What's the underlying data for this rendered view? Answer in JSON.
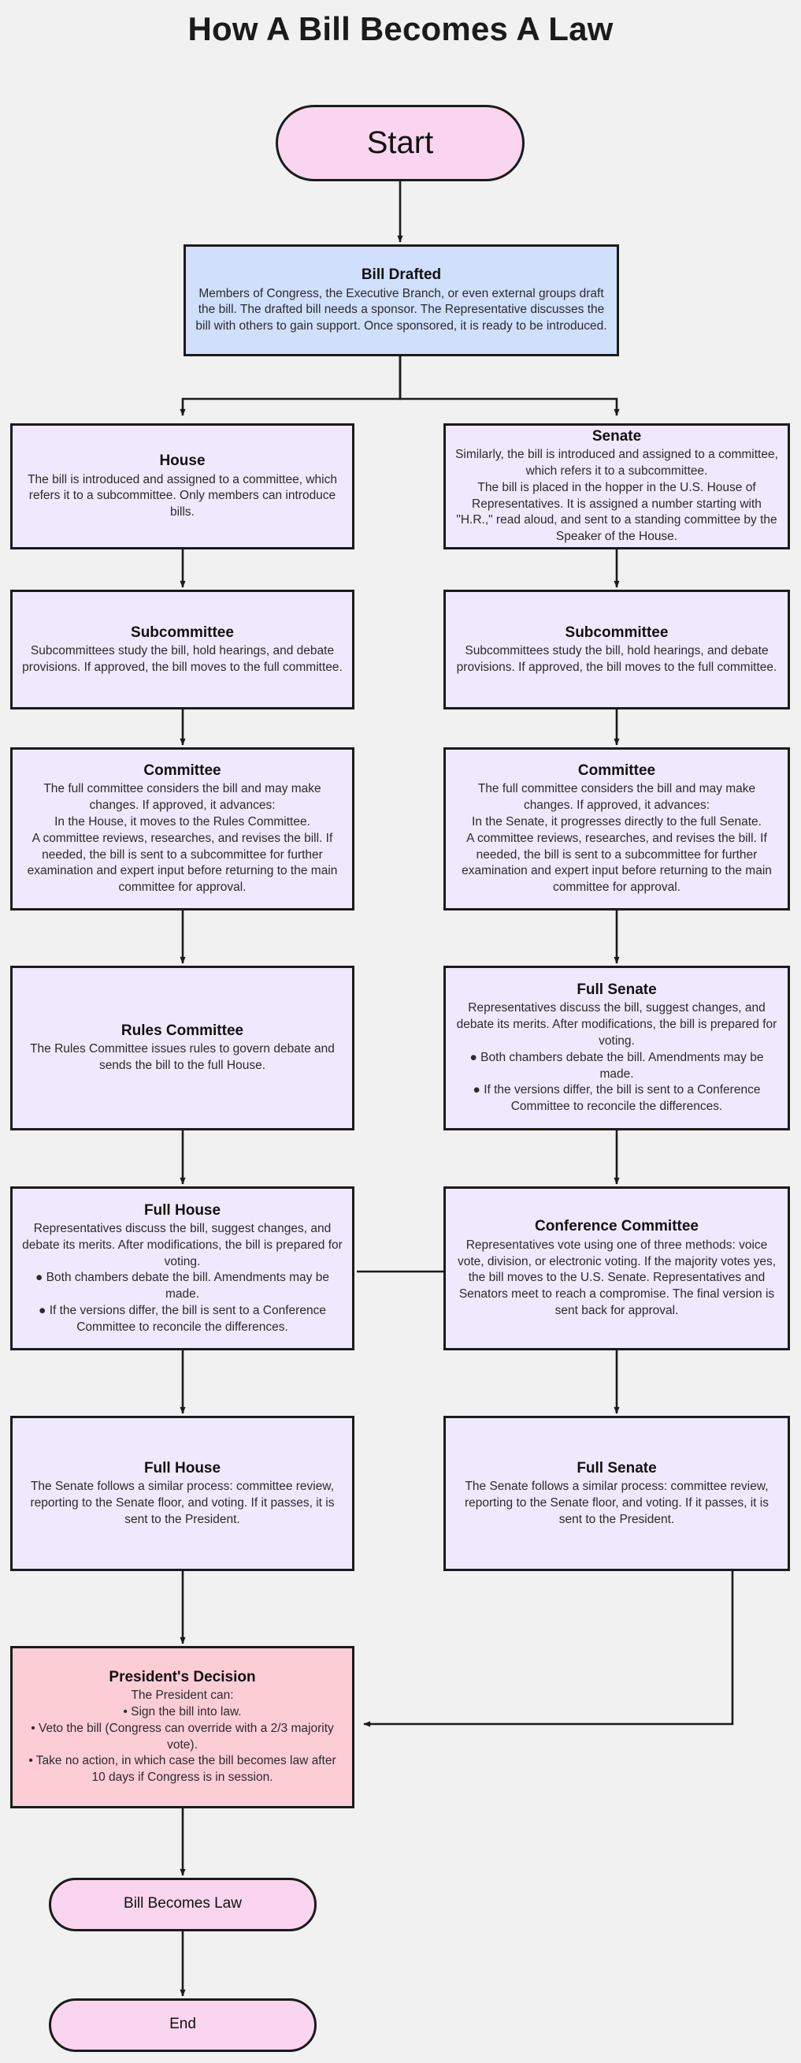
{
  "title": "How A Bill Becomes A Law",
  "colors": {
    "background": "#f2f1f1",
    "terminal_fill": "#f9d5ef",
    "drafted_fill": "#cfdffc",
    "process_fill": "#efe9fd",
    "president_fill": "#fdcdd6",
    "stroke": "#1b1b1b"
  },
  "nodes": {
    "start": {
      "label": "Start",
      "shape": "terminal"
    },
    "bill_drafted": {
      "title": "Bill Drafted",
      "body": "Members of Congress, the Executive Branch, or even external groups draft the bill. The drafted bill needs a sponsor. The Representative discusses the bill with others to gain support. Once sponsored, it is ready to be introduced.",
      "shape": "process"
    },
    "house": {
      "title": "House",
      "body": "The bill is introduced and assigned to a committee, which refers it to a subcommittee. Only members can introduce bills.",
      "shape": "process"
    },
    "senate": {
      "title": "Senate",
      "body": "Similarly, the bill is introduced and assigned to a committee, which refers it to a subcommittee.\nThe bill is placed in the hopper in the U.S. House of Representatives. It is assigned a number starting with \"H.R.,\" read aloud, and sent to a standing committee by the Speaker of the House.",
      "shape": "process"
    },
    "house_subcommittee": {
      "title": "Subcommittee",
      "body": "Subcommittees study the bill, hold hearings, and debate provisions. If approved, the bill moves to the full committee.",
      "shape": "process"
    },
    "senate_subcommittee": {
      "title": "Subcommittee",
      "body": "Subcommittees study the bill, hold hearings, and debate provisions. If approved, the bill moves to the full committee.",
      "shape": "process"
    },
    "house_committee": {
      "title": "Committee",
      "body": "The full committee considers the bill and may make changes. If approved, it advances:\nIn the House, it moves to the Rules Committee.\nA committee reviews, researches, and revises the bill. If needed, the bill is sent to a subcommittee for further examination and expert input before returning to the main committee for approval.",
      "shape": "process"
    },
    "senate_committee": {
      "title": "Committee",
      "body": "The full committee considers the bill and may make changes. If approved, it advances:\nIn the Senate, it progresses directly to the full Senate.\nA committee reviews, researches, and revises the bill. If needed, the bill is sent to a subcommittee for further examination and expert input before returning to the main committee for approval.",
      "shape": "process"
    },
    "rules_committee": {
      "title": "Rules Committee",
      "body": "The Rules Committee issues rules to govern debate and sends the bill to the full House.",
      "shape": "process"
    },
    "full_senate_debate": {
      "title": "Full Senate",
      "body": "Representatives discuss the bill, suggest changes, and debate its merits. After modifications, the bill is prepared for voting.\n● Both chambers debate the bill. Amendments may be made.\n● If the versions differ, the bill is sent to a Conference Committee to reconcile the differences.",
      "shape": "process"
    },
    "full_house_debate": {
      "title": "Full House",
      "body": "Representatives discuss the bill, suggest changes, and debate its merits. After modifications, the bill is prepared for voting.\n● Both chambers debate the bill. Amendments may be made.\n● If the versions differ, the bill is sent to a Conference Committee to reconcile the differences.",
      "shape": "process"
    },
    "conference_committee": {
      "title": "Conference Committee",
      "body": "Representatives vote using one of three methods: voice vote, division, or electronic voting. If the majority votes yes, the bill moves to the U.S. Senate. Representatives and Senators meet to reach a compromise. The final version is sent back for approval.",
      "shape": "process"
    },
    "full_house_vote": {
      "title": "Full House",
      "body": "The Senate follows a similar process: committee review, reporting to the Senate floor, and voting. If it passes, it is sent to the President.",
      "shape": "process"
    },
    "full_senate_vote": {
      "title": "Full Senate",
      "body": "The Senate follows a similar process: committee review, reporting to the Senate floor, and voting. If it passes, it is sent to the President.",
      "shape": "process"
    },
    "presidents_decision": {
      "title": "President's Decision",
      "body": "The President can:\n•  Sign the bill into law.\n•  Veto the bill (Congress can override with a 2/3 majority vote).\n•  Take no action, in which case the bill becomes law after 10 days if Congress is in session.",
      "shape": "process"
    },
    "bill_becomes_law": {
      "label": "Bill Becomes Law",
      "shape": "terminal"
    },
    "end": {
      "label": "End",
      "shape": "terminal"
    }
  },
  "edges": [
    {
      "from": "start",
      "to": "bill_drafted"
    },
    {
      "from": "bill_drafted",
      "to": "house"
    },
    {
      "from": "bill_drafted",
      "to": "senate"
    },
    {
      "from": "house",
      "to": "house_subcommittee"
    },
    {
      "from": "senate",
      "to": "senate_subcommittee"
    },
    {
      "from": "house_subcommittee",
      "to": "house_committee"
    },
    {
      "from": "senate_subcommittee",
      "to": "senate_committee"
    },
    {
      "from": "house_committee",
      "to": "rules_committee"
    },
    {
      "from": "senate_committee",
      "to": "full_senate_debate"
    },
    {
      "from": "rules_committee",
      "to": "full_house_debate"
    },
    {
      "from": "full_senate_debate",
      "to": "conference_committee"
    },
    {
      "from": "full_house_debate",
      "to": "conference_committee"
    },
    {
      "from": "full_house_debate",
      "to": "full_house_vote"
    },
    {
      "from": "conference_committee",
      "to": "full_senate_vote"
    },
    {
      "from": "full_house_vote",
      "to": "presidents_decision"
    },
    {
      "from": "full_senate_vote",
      "to": "presidents_decision"
    },
    {
      "from": "presidents_decision",
      "to": "bill_becomes_law"
    },
    {
      "from": "bill_becomes_law",
      "to": "end"
    }
  ]
}
